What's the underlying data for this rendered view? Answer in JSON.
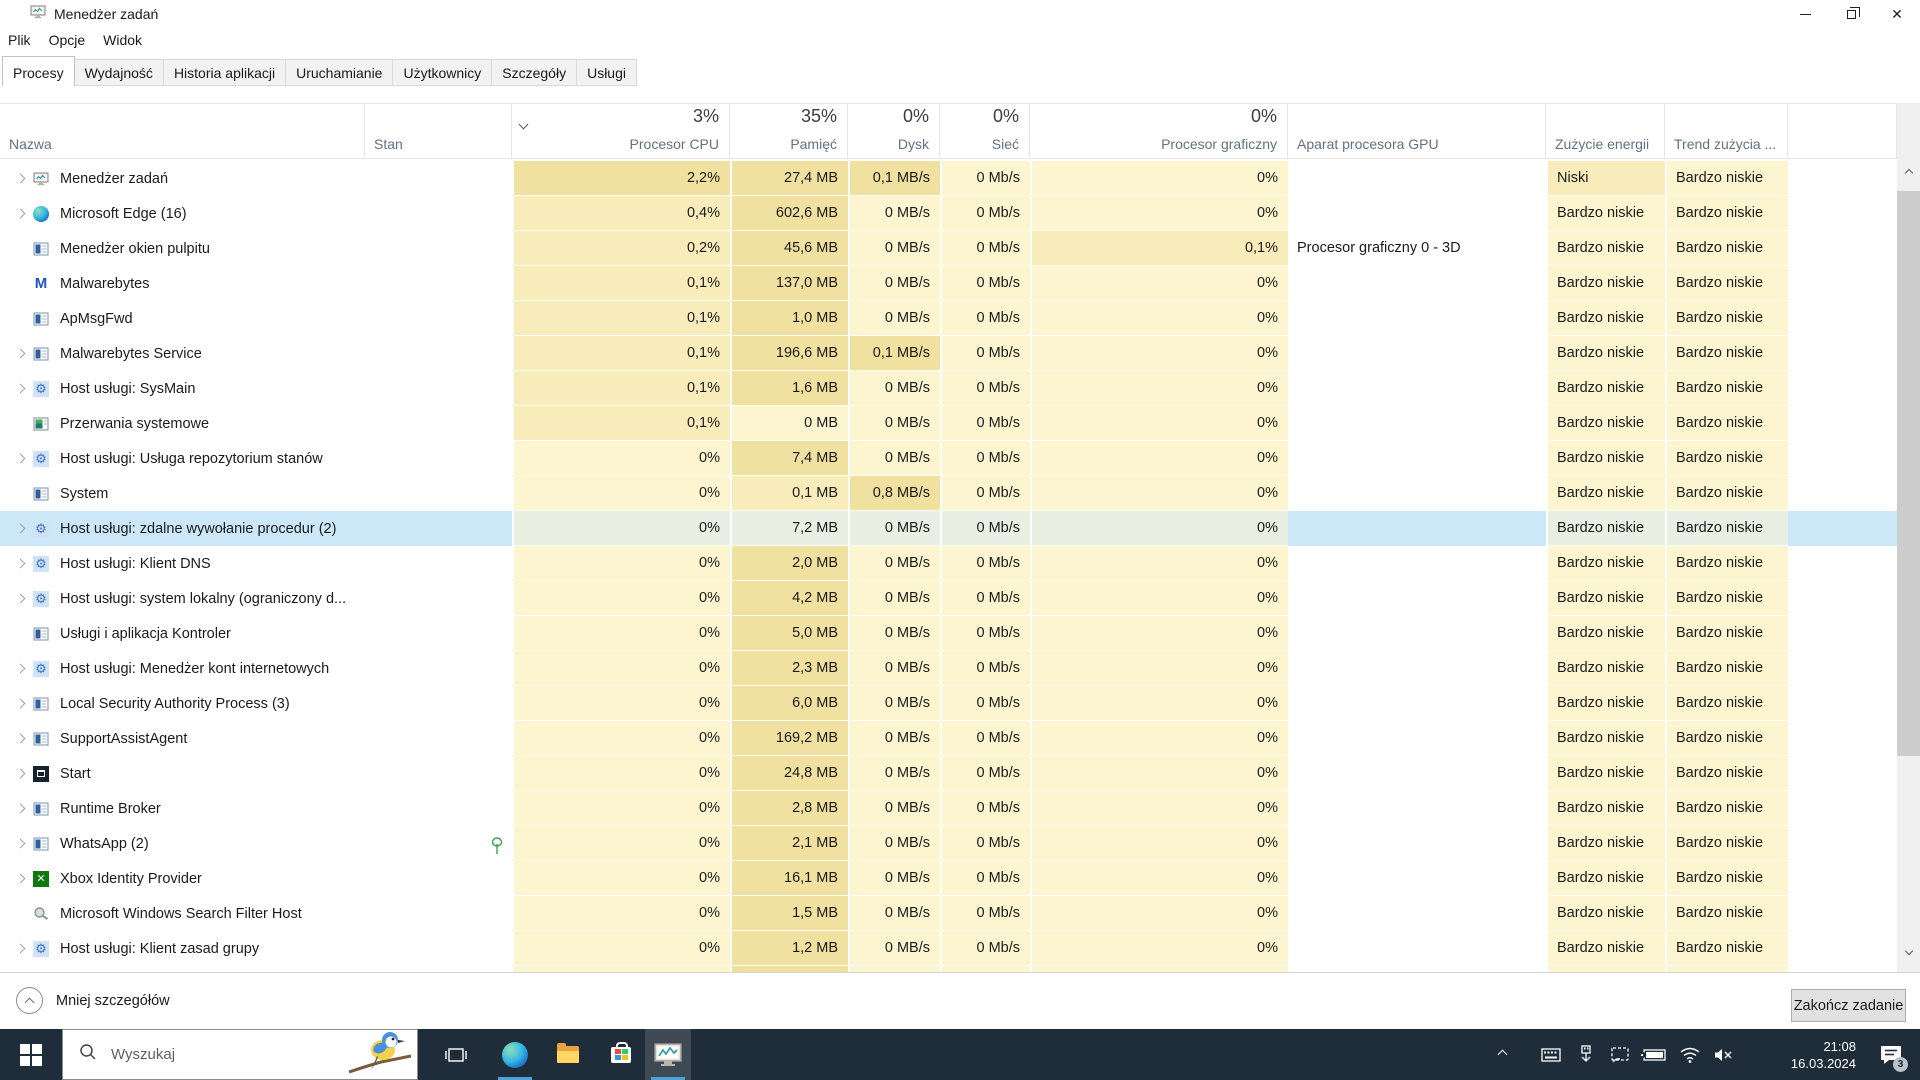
{
  "window": {
    "title": "Menedżer zadań",
    "controls": {
      "minimize": "minimize",
      "restore": "restore",
      "close": "close"
    }
  },
  "menu": {
    "items": [
      "Plik",
      "Opcje",
      "Widok"
    ]
  },
  "tabs": {
    "items": [
      "Procesy",
      "Wydajność",
      "Historia aplikacji",
      "Uruchamianie",
      "Użytkownicy",
      "Szczegóły",
      "Usługi"
    ],
    "selected": "Procesy"
  },
  "columns": {
    "name": "Nazwa",
    "status": "Stan",
    "cpu": "Procesor CPU",
    "memory": "Pamięć",
    "disk": "Dysk",
    "network": "Sieć",
    "gpu": "Procesor graficzny",
    "gpu_engine": "Aparat procesora GPU",
    "power": "Zużycie energii",
    "trend": "Trend zużycia ...",
    "totals": {
      "cpu": "3%",
      "memory": "35%",
      "disk": "0%",
      "network": "0%",
      "gpu": "0%"
    }
  },
  "rows": [
    {
      "name": "Menedżer zadań",
      "icon": "task-manager",
      "expand": true,
      "cpu": "2,2%",
      "memory": "27,4 MB",
      "disk": "0,1 MB/s",
      "network": "0 Mb/s",
      "gpu": "0%",
      "gpu_engine": "",
      "power": "Niski",
      "trend": "Bardzo niskie",
      "selected": false,
      "status_leaf": false
    },
    {
      "name": "Microsoft Edge (16)",
      "icon": "edge",
      "expand": true,
      "cpu": "0,4%",
      "memory": "602,6 MB",
      "disk": "0 MB/s",
      "network": "0 Mb/s",
      "gpu": "0%",
      "gpu_engine": "",
      "power": "Bardzo niskie",
      "trend": "Bardzo niskie",
      "selected": false,
      "status_leaf": false
    },
    {
      "name": "Menedżer okien pulpitu",
      "icon": "app-window",
      "expand": false,
      "cpu": "0,2%",
      "memory": "45,6 MB",
      "disk": "0 MB/s",
      "network": "0 Mb/s",
      "gpu": "0,1%",
      "gpu_engine": "Procesor graficzny 0 - 3D",
      "power": "Bardzo niskie",
      "trend": "Bardzo niskie",
      "selected": false,
      "status_leaf": false
    },
    {
      "name": "Malwarebytes",
      "icon": "malwarebytes",
      "expand": false,
      "cpu": "0,1%",
      "memory": "137,0 MB",
      "disk": "0 MB/s",
      "network": "0 Mb/s",
      "gpu": "0%",
      "gpu_engine": "",
      "power": "Bardzo niskie",
      "trend": "Bardzo niskie",
      "selected": false,
      "status_leaf": false
    },
    {
      "name": "ApMsgFwd",
      "icon": "app-window",
      "expand": false,
      "cpu": "0,1%",
      "memory": "1,0 MB",
      "disk": "0 MB/s",
      "network": "0 Mb/s",
      "gpu": "0%",
      "gpu_engine": "",
      "power": "Bardzo niskie",
      "trend": "Bardzo niskie",
      "selected": false,
      "status_leaf": false
    },
    {
      "name": "Malwarebytes Service",
      "icon": "app-window",
      "expand": true,
      "cpu": "0,1%",
      "memory": "196,6 MB",
      "disk": "0,1 MB/s",
      "network": "0 Mb/s",
      "gpu": "0%",
      "gpu_engine": "",
      "power": "Bardzo niskie",
      "trend": "Bardzo niskie",
      "selected": false,
      "status_leaf": false
    },
    {
      "name": "Host usługi: SysMain",
      "icon": "gear",
      "expand": true,
      "cpu": "0,1%",
      "memory": "1,6 MB",
      "disk": "0 MB/s",
      "network": "0 Mb/s",
      "gpu": "0%",
      "gpu_engine": "",
      "power": "Bardzo niskie",
      "trend": "Bardzo niskie",
      "selected": false,
      "status_leaf": false
    },
    {
      "name": "Przerwania systemowe",
      "icon": "system-interrupts",
      "expand": false,
      "cpu": "0,1%",
      "memory": "0 MB",
      "disk": "0 MB/s",
      "network": "0 Mb/s",
      "gpu": "0%",
      "gpu_engine": "",
      "power": "Bardzo niskie",
      "trend": "Bardzo niskie",
      "selected": false,
      "status_leaf": false
    },
    {
      "name": "Host usługi: Usługa repozytorium stanów",
      "icon": "gear",
      "expand": true,
      "cpu": "0%",
      "memory": "7,4 MB",
      "disk": "0 MB/s",
      "network": "0 Mb/s",
      "gpu": "0%",
      "gpu_engine": "",
      "power": "Bardzo niskie",
      "trend": "Bardzo niskie",
      "selected": false,
      "status_leaf": false
    },
    {
      "name": "System",
      "icon": "app-window",
      "expand": false,
      "cpu": "0%",
      "memory": "0,1 MB",
      "disk": "0,8 MB/s",
      "network": "0 Mb/s",
      "gpu": "0%",
      "gpu_engine": "",
      "power": "Bardzo niskie",
      "trend": "Bardzo niskie",
      "selected": false,
      "status_leaf": false
    },
    {
      "name": "Host usługi: zdalne wywołanie procedur (2)",
      "icon": "gear",
      "expand": true,
      "cpu": "0%",
      "memory": "7,2 MB",
      "disk": "0 MB/s",
      "network": "0 Mb/s",
      "gpu": "0%",
      "gpu_engine": "",
      "power": "Bardzo niskie",
      "trend": "Bardzo niskie",
      "selected": true,
      "status_leaf": false
    },
    {
      "name": "Host usługi: Klient DNS",
      "icon": "gear",
      "expand": true,
      "cpu": "0%",
      "memory": "2,0 MB",
      "disk": "0 MB/s",
      "network": "0 Mb/s",
      "gpu": "0%",
      "gpu_engine": "",
      "power": "Bardzo niskie",
      "trend": "Bardzo niskie",
      "selected": false,
      "status_leaf": false
    },
    {
      "name": "Host usługi: system lokalny (ograniczony d...",
      "icon": "gear",
      "expand": true,
      "cpu": "0%",
      "memory": "4,2 MB",
      "disk": "0 MB/s",
      "network": "0 Mb/s",
      "gpu": "0%",
      "gpu_engine": "",
      "power": "Bardzo niskie",
      "trend": "Bardzo niskie",
      "selected": false,
      "status_leaf": false
    },
    {
      "name": "Usługi i aplikacja Kontroler",
      "icon": "app-window",
      "expand": false,
      "cpu": "0%",
      "memory": "5,0 MB",
      "disk": "0 MB/s",
      "network": "0 Mb/s",
      "gpu": "0%",
      "gpu_engine": "",
      "power": "Bardzo niskie",
      "trend": "Bardzo niskie",
      "selected": false,
      "status_leaf": false
    },
    {
      "name": "Host usługi: Menedżer kont internetowych",
      "icon": "gear",
      "expand": true,
      "cpu": "0%",
      "memory": "2,3 MB",
      "disk": "0 MB/s",
      "network": "0 Mb/s",
      "gpu": "0%",
      "gpu_engine": "",
      "power": "Bardzo niskie",
      "trend": "Bardzo niskie",
      "selected": false,
      "status_leaf": false
    },
    {
      "name": "Local Security Authority Process (3)",
      "icon": "app-window",
      "expand": true,
      "cpu": "0%",
      "memory": "6,0 MB",
      "disk": "0 MB/s",
      "network": "0 Mb/s",
      "gpu": "0%",
      "gpu_engine": "",
      "power": "Bardzo niskie",
      "trend": "Bardzo niskie",
      "selected": false,
      "status_leaf": false
    },
    {
      "name": "SupportAssistAgent",
      "icon": "app-window",
      "expand": true,
      "cpu": "0%",
      "memory": "169,2 MB",
      "disk": "0 MB/s",
      "network": "0 Mb/s",
      "gpu": "0%",
      "gpu_engine": "",
      "power": "Bardzo niskie",
      "trend": "Bardzo niskie",
      "selected": false,
      "status_leaf": false
    },
    {
      "name": "Start",
      "icon": "start-menu",
      "expand": true,
      "cpu": "0%",
      "memory": "24,8 MB",
      "disk": "0 MB/s",
      "network": "0 Mb/s",
      "gpu": "0%",
      "gpu_engine": "",
      "power": "Bardzo niskie",
      "trend": "Bardzo niskie",
      "selected": false,
      "status_leaf": false
    },
    {
      "name": "Runtime Broker",
      "icon": "app-window",
      "expand": true,
      "cpu": "0%",
      "memory": "2,8 MB",
      "disk": "0 MB/s",
      "network": "0 Mb/s",
      "gpu": "0%",
      "gpu_engine": "",
      "power": "Bardzo niskie",
      "trend": "Bardzo niskie",
      "selected": false,
      "status_leaf": false
    },
    {
      "name": "WhatsApp (2)",
      "icon": "app-window",
      "expand": true,
      "cpu": "0%",
      "memory": "2,1 MB",
      "disk": "0 MB/s",
      "network": "0 Mb/s",
      "gpu": "0%",
      "gpu_engine": "",
      "power": "Bardzo niskie",
      "trend": "Bardzo niskie",
      "selected": false,
      "status_leaf": true
    },
    {
      "name": "Xbox Identity Provider",
      "icon": "xbox",
      "expand": true,
      "cpu": "0%",
      "memory": "16,1 MB",
      "disk": "0 MB/s",
      "network": "0 Mb/s",
      "gpu": "0%",
      "gpu_engine": "",
      "power": "Bardzo niskie",
      "trend": "Bardzo niskie",
      "selected": false,
      "status_leaf": false
    },
    {
      "name": "Microsoft Windows Search Filter Host",
      "icon": "search-host",
      "expand": false,
      "cpu": "0%",
      "memory": "1,5 MB",
      "disk": "0 MB/s",
      "network": "0 Mb/s",
      "gpu": "0%",
      "gpu_engine": "",
      "power": "Bardzo niskie",
      "trend": "Bardzo niskie",
      "selected": false,
      "status_leaf": false
    },
    {
      "name": "Host usługi: Klient zasad grupy",
      "icon": "gear",
      "expand": true,
      "cpu": "0%",
      "memory": "1,2 MB",
      "disk": "0 MB/s",
      "network": "0 Mb/s",
      "gpu": "0%",
      "gpu_engine": "",
      "power": "Bardzo niskie",
      "trend": "Bardzo niskie",
      "selected": false,
      "status_leaf": false
    }
  ],
  "footer": {
    "less_details": "Mniej szczegółów",
    "end_task": "Zakończ zadanie"
  },
  "taskbar": {
    "search_placeholder": "Wyszukaj",
    "clock_time": "21:08",
    "clock_date": "16.03.2024",
    "notification_count": "3"
  },
  "colors": {
    "heat_low": "#fdf5d0",
    "heat_mid": "#f8ecbb",
    "heat_high": "#f1e1a0",
    "selection": "#cce8f8",
    "taskbar": "#1f2c39",
    "accent_underline": "#4aa3df"
  }
}
